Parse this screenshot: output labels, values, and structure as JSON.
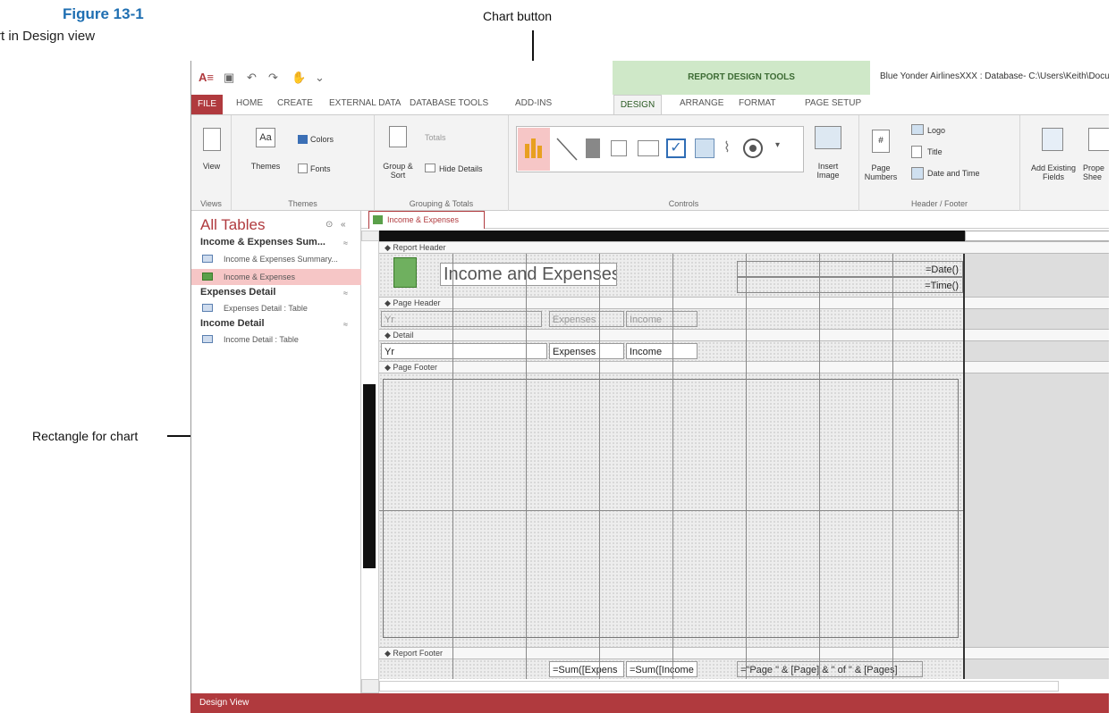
{
  "figure": {
    "number": "Figure 13-1",
    "caption": "rt in Design view"
  },
  "callouts": {
    "chart_button": "Chart button",
    "rectangle": "Rectangle for chart"
  },
  "app": {
    "context_tab": "REPORT DESIGN TOOLS",
    "window_title": "Blue Yonder AirlinesXXX : Database- C:\\Users\\Keith\\Docu",
    "tabs": [
      "HOME",
      "CREATE",
      "EXTERNAL DATA",
      "DATABASE TOOLS",
      "ADD-INS",
      "ARRANGE",
      "FORMAT",
      "PAGE SETUP"
    ],
    "file_tab": "FILE",
    "active_tab": "DESIGN",
    "status": "Design View"
  },
  "ribbon": {
    "views": {
      "label": "View",
      "group": "Views"
    },
    "themes": {
      "themes": "Themes",
      "colors": "Colors",
      "fonts": "Fonts",
      "group": "Themes"
    },
    "grouping": {
      "group_sort": "Group & Sort",
      "totals": "Totals",
      "hide_details": "Hide Details",
      "group": "Grouping & Totals"
    },
    "controls": {
      "group": "Controls"
    },
    "insert_image": "Insert Image",
    "header_footer": {
      "page_numbers": "Page Numbers",
      "logo": "Logo",
      "title": "Title",
      "date_time": "Date and Time",
      "group": "Header / Footer"
    },
    "tools": {
      "add_existing": "Add Existing Fields",
      "property_sheet": "Prope Shee"
    }
  },
  "nav": {
    "title": "All Tables",
    "sections": [
      {
        "name": "Income & Expenses Sum...",
        "items": [
          "Income & Expenses Summary...",
          "Income & Expenses"
        ]
      },
      {
        "name": "Expenses Detail",
        "items": [
          "Expenses Detail : Table"
        ]
      },
      {
        "name": "Income Detail",
        "items": [
          "Income Detail : Table"
        ]
      }
    ]
  },
  "report": {
    "tab": "Income & Expenses",
    "sections": [
      "Report Header",
      "Page Header",
      "Detail",
      "Page Footer",
      "Report Footer"
    ],
    "title": "Income and Expenses",
    "date_fn": "=Date()",
    "time_fn": "=Time()",
    "ph_yr": "Yr",
    "ph_exp": "Expenses",
    "ph_inc": "Income",
    "d_yr": "Yr",
    "d_exp": "Expenses",
    "d_inc": "Income",
    "sum_exp": "=Sum([Expens",
    "sum_inc": "=Sum([Income",
    "page_expr": "=\"Page \" & [Page] & \" of \" & [Pages]"
  }
}
